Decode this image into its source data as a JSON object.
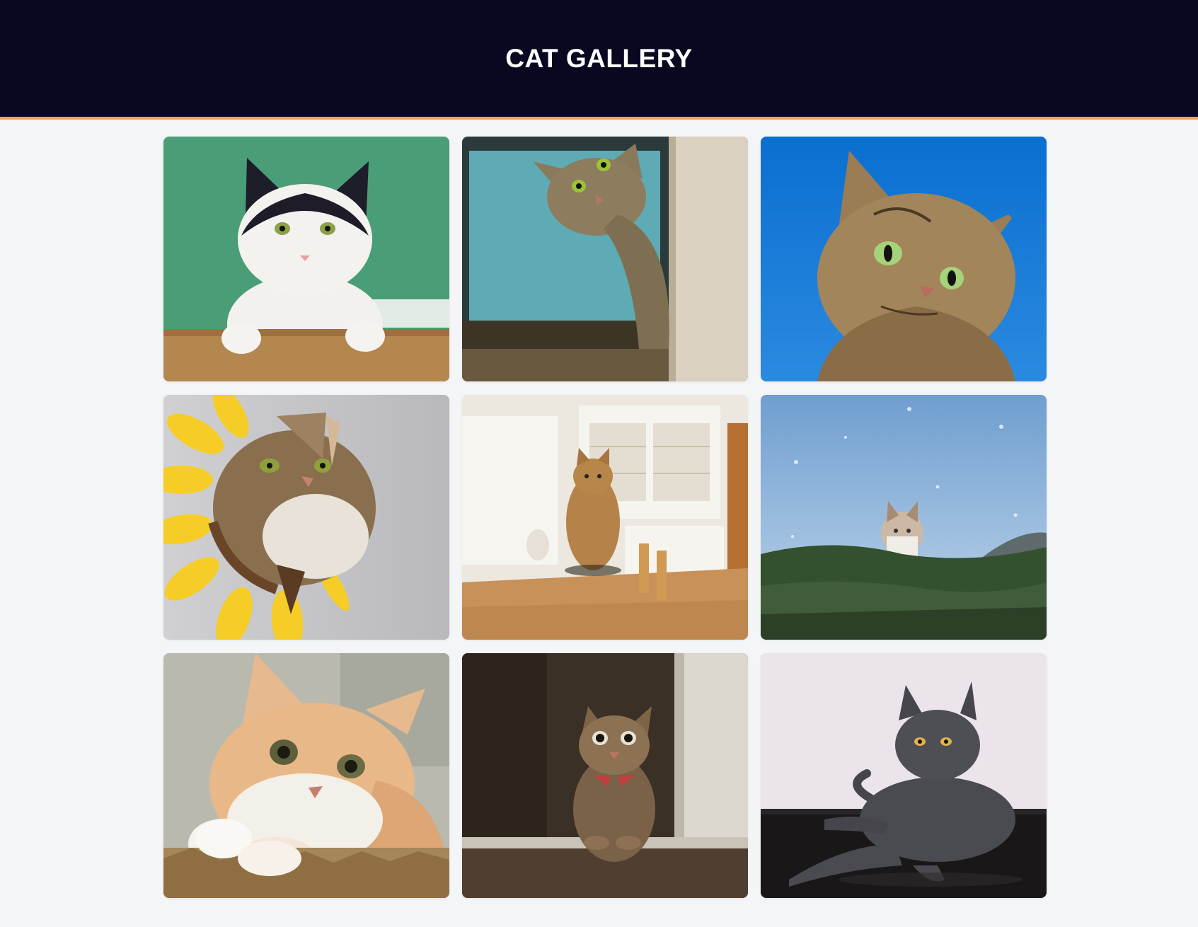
{
  "header": {
    "title": "CAT GALLERY"
  },
  "gallery": {
    "items": [
      {
        "name": "cat-photo-tuxedo",
        "bg": "#4ea77e",
        "fur": "#f2f0ec",
        "accent": "#1c1c26"
      },
      {
        "name": "cat-photo-peeking-tabby",
        "bg": "#5fa9b3",
        "fur": "#8a7a5c",
        "accent": "#d8cdb8"
      },
      {
        "name": "cat-photo-blue-sky-tabby",
        "bg": "#1f7fd0",
        "fur": "#9c7f55",
        "accent": "#3a2c1c"
      },
      {
        "name": "cat-photo-sunflower-costume",
        "bg": "#c9c9cc",
        "fur": "#8c7758",
        "accent": "#f6d23a"
      },
      {
        "name": "cat-photo-kitchen-table",
        "bg": "#eeeae2",
        "fur": "#b08048",
        "accent": "#c9925a"
      },
      {
        "name": "cat-photo-grass-field",
        "bg": "#8db2d6",
        "fur": "#c8b8a6",
        "accent": "#2f4a2c"
      },
      {
        "name": "cat-photo-ginger-white",
        "bg": "#b7b7ad",
        "fur": "#e4b487",
        "accent": "#a88a62"
      },
      {
        "name": "cat-photo-doorway-tabby",
        "bg": "#3a3027",
        "fur": "#8a6f50",
        "accent": "#c23b3b"
      },
      {
        "name": "cat-photo-gray-lying",
        "bg": "#ece4ea",
        "fur": "#4c4c52",
        "accent": "#161616"
      }
    ]
  }
}
